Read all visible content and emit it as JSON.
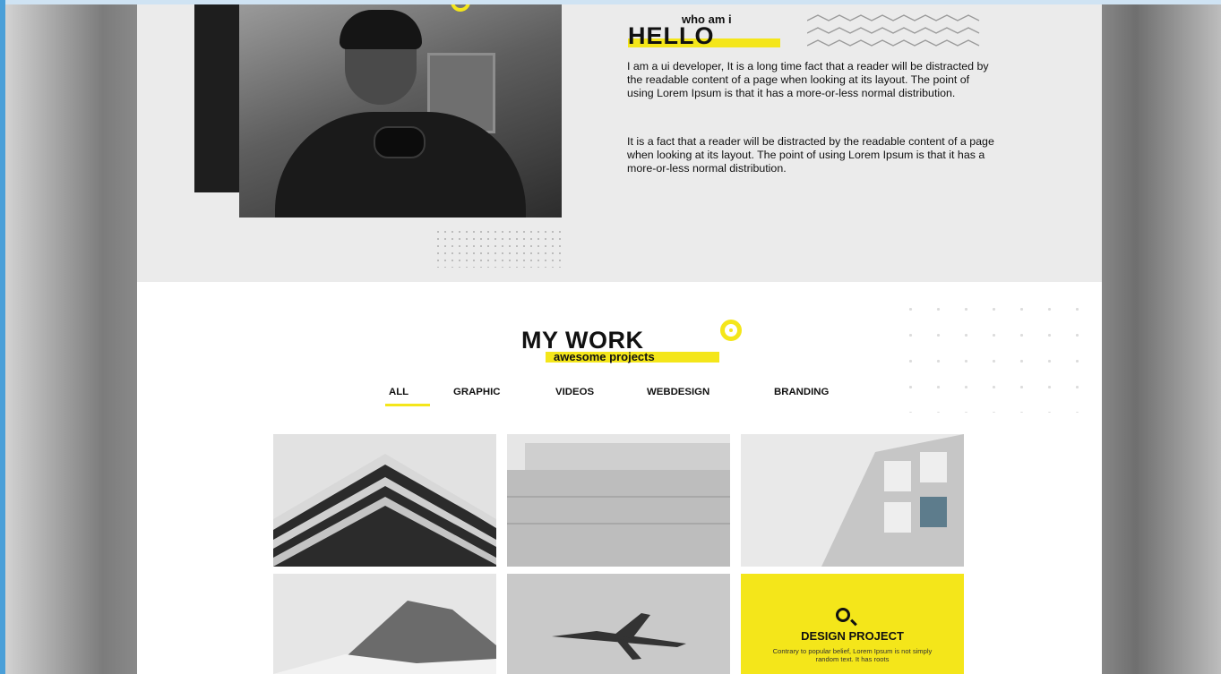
{
  "about": {
    "eyebrow": "who am i",
    "heading": "HELLO",
    "paragraphs": [
      "I am a ui developer, It is a long time fact that a reader will be distracted by the readable content of a page when looking at its layout. The point of using Lorem Ipsum is that it has a more-or-less normal distribution.",
      "It is a fact that a reader will be distracted by the readable content of a page when looking at its layout. The point of using Lorem Ipsum is that it has a more-or-less normal distribution."
    ]
  },
  "work": {
    "title": "MY WORK",
    "subtitle": "awesome projects",
    "tabs": [
      "ALL",
      "GRAPHIC",
      "VIDEOS",
      "WEBDESIGN",
      "BRANDING"
    ],
    "active_tab": "ALL",
    "featured": {
      "icon": "search-icon",
      "title": "DESIGN PROJECT",
      "description": "Contrary to popular belief, Lorem Ipsum is not simply random text. It has roots"
    }
  },
  "colors": {
    "accent": "#f4e61a",
    "text": "#111111",
    "about_bg": "#ebebeb"
  }
}
